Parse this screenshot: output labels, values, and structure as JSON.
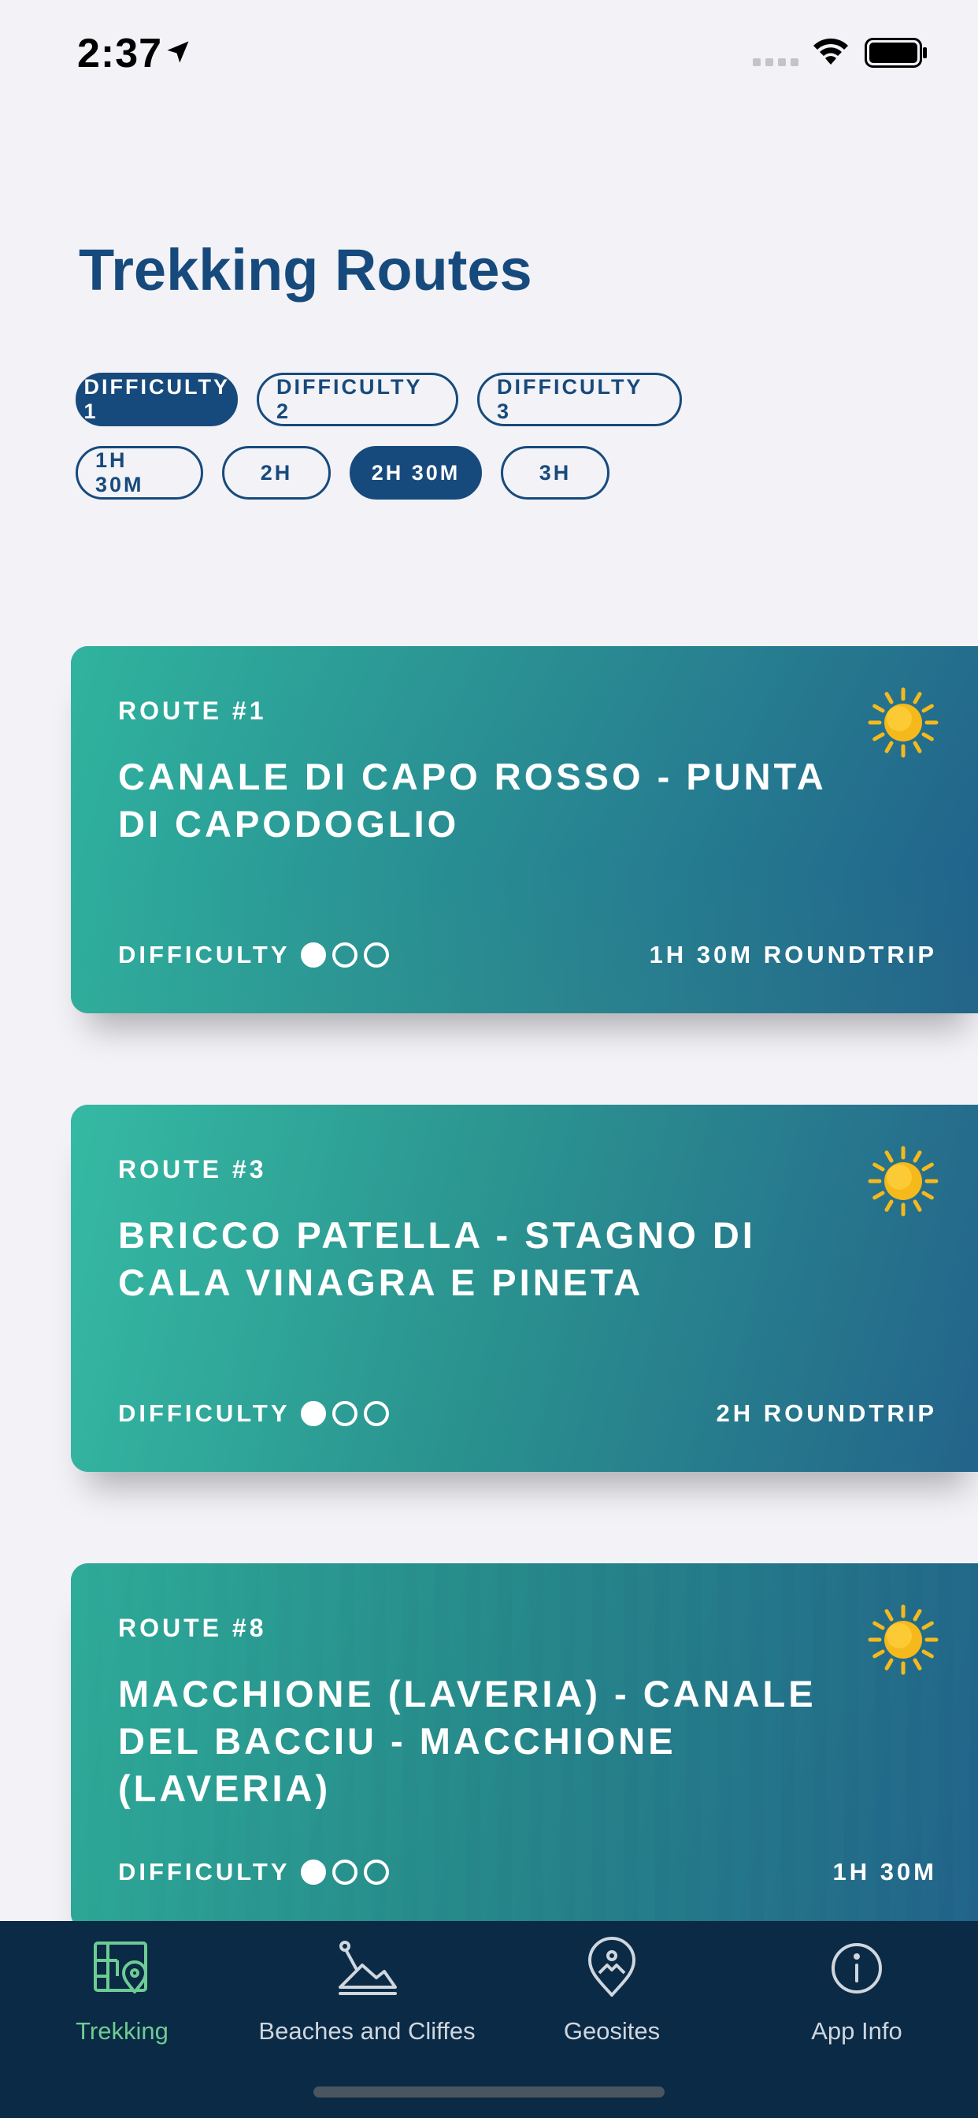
{
  "status_bar": {
    "time": "2:37"
  },
  "page": {
    "title": "Trekking Routes"
  },
  "filters": {
    "difficulty": [
      {
        "label": "DIFFICULTY 1",
        "active": true
      },
      {
        "label": "DIFFICULTY 2",
        "active": false
      },
      {
        "label": "DIFFICULTY 3",
        "active": false
      }
    ],
    "duration": [
      {
        "label": "1H 30M",
        "active": false
      },
      {
        "label": "2H",
        "active": false
      },
      {
        "label": "2H 30M",
        "active": true
      },
      {
        "label": "3H",
        "active": false
      }
    ]
  },
  "routes": [
    {
      "number": "ROUTE #1",
      "title": "CANALE DI CAPO ROSSO - PUNTA DI CAPODOGLIO",
      "difficulty_label": "DIFFICULTY",
      "difficulty": 1,
      "duration": "1H 30M ROUNDTRIP",
      "weather_icon": "sun-icon"
    },
    {
      "number": "ROUTE #3",
      "title": "BRICCO PATELLA - STAGNO DI CALA VINAGRA E PINETA",
      "difficulty_label": "DIFFICULTY",
      "difficulty": 1,
      "duration": "2H ROUNDTRIP",
      "weather_icon": "sun-icon"
    },
    {
      "number": "ROUTE #8",
      "title": "MACCHIONE (LAVERIA) - CANALE DEL BACCIU - MACCHIONE (LAVERIA)",
      "difficulty_label": "DIFFICULTY",
      "difficulty": 1,
      "duration": "1H 30M",
      "weather_icon": "sun-icon"
    }
  ],
  "tab_bar": {
    "tabs": [
      {
        "label": "Trekking",
        "icon": "map-pin-icon",
        "active": true
      },
      {
        "label": "Beaches and Cliffes",
        "icon": "beach-icon",
        "active": false
      },
      {
        "label": "Geosites",
        "icon": "geosite-pin-icon",
        "active": false
      },
      {
        "label": "App Info",
        "icon": "info-icon",
        "active": false
      }
    ]
  },
  "colors": {
    "primary": "#174a7c",
    "tab_bar_bg": "#0a2a45",
    "tab_active": "#6dcc93",
    "card_teal": "#2fb59f",
    "card_blue": "#1e5f8c",
    "sun": "#f5b91c"
  }
}
